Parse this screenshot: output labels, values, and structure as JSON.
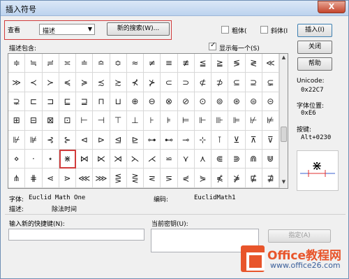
{
  "window": {
    "title": "插入符号",
    "close_label": "X"
  },
  "view": {
    "label": "查看",
    "dropdown_value": "描述",
    "new_search_label": "新的搜索(W)..."
  },
  "style_options": {
    "bold_label": "粗体(",
    "italic_label": "斜体(I"
  },
  "buttons": {
    "insert": "插入(I)",
    "close": "关闭",
    "help": "帮助",
    "assign": "指定(A)"
  },
  "grid": {
    "description_label": "描述包含:",
    "show_each_label": "显示每一个(S)",
    "symbols": [
      "≑",
      "≒",
      "≓",
      "≍",
      "≐",
      "≏",
      "≎",
      "≈",
      "≠",
      "≡",
      "≢",
      "≦",
      "≧",
      "≶",
      "≷",
      "≪",
      "≫",
      "≺",
      "≻",
      "≼",
      "≽",
      "≾",
      "≿",
      "⊀",
      "⊁",
      "⊂",
      "⊃",
      "⊄",
      "⊅",
      "⊆",
      "⊇",
      "⊊",
      "⊋",
      "⊏",
      "⊐",
      "⊑",
      "⊒",
      "⊓",
      "⊔",
      "⊕",
      "⊖",
      "⊗",
      "⊘",
      "⊙",
      "⊚",
      "⊛",
      "⊜",
      "⊝",
      "⊞",
      "⊟",
      "⊠",
      "⊡",
      "⊢",
      "⊣",
      "⊤",
      "⊥",
      "⊦",
      "⊧",
      "⊨",
      "⊩",
      "⊪",
      "⊫",
      "⊬",
      "⊭",
      "⊮",
      "⊯",
      "⊰",
      "⊱",
      "⊲",
      "⊳",
      "⊴",
      "⊵",
      "⊶",
      "⊷",
      "⊸",
      "⊹",
      "⊺",
      "⊻",
      "⊼",
      "⊽",
      "⋄",
      "⋅",
      "⋆",
      "⋇",
      "⋈",
      "⋉",
      "⋊",
      "⋋",
      "⋌",
      "⋍",
      "⋎",
      "⋏",
      "⋐",
      "⋑",
      "⋒",
      "⋓",
      "⋔",
      "⋕",
      "⋖",
      "⋗",
      "⋘",
      "⋙",
      "⋚",
      "⋛",
      "⋜",
      "⋝",
      "⋞",
      "⋟",
      "⋠",
      "⋡",
      "⋢",
      "⋣"
    ],
    "selected_index": 83
  },
  "info": {
    "unicode_label": "Unicode:",
    "unicode_value": "0x22C7",
    "font_pos_label": "字体位置:",
    "font_pos_value": "0xE6",
    "key_label": "按键:",
    "key_value": "Alt+0230",
    "font_label": "字体:",
    "font_value": "Euclid Math One",
    "encoding_label": "编码:",
    "encoding_value": "EuclidMath1",
    "desc_label": "描述:",
    "desc_value": "除法时间"
  },
  "shortcut": {
    "new_key_label": "输入新的快捷键(N):",
    "current_key_label": "当前密钥(U):"
  },
  "watermark": {
    "title": "Office教程网",
    "url": "www.office26.com"
  }
}
